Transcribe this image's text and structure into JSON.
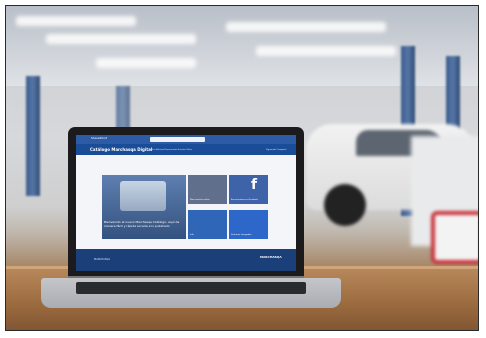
{
  "screen": {
    "app_title": "SharePoint",
    "site_title": "Catálogo Marchasqa Digital",
    "nav_links": "Inicio   Noticias   Documentos   Eventos   Sitios",
    "nav_right": "Siguiendo   Compartir",
    "hero_text": "Bienvenido al nuevo Marchasqa Catálogo, aquí de manera fácil y rápida accede a lo publicado",
    "tiles": [
      {
        "caption": "Mas trámites online",
        "color": "#5f6f8c"
      },
      {
        "caption": "Encuentranos en Facebook",
        "color": "#3f63a8"
      },
      {
        "caption": "Info",
        "color": "#2f66b8"
      },
      {
        "caption": "Sistemas integrados",
        "color": "#2c67c9"
      }
    ],
    "footer_logo": "MARCHASQA",
    "footer_right": "MARCHASQA"
  },
  "colors": {
    "app_bar": "#2e5ba5",
    "nav_bar": "#1a4d97",
    "footer": "#1b3f78"
  }
}
